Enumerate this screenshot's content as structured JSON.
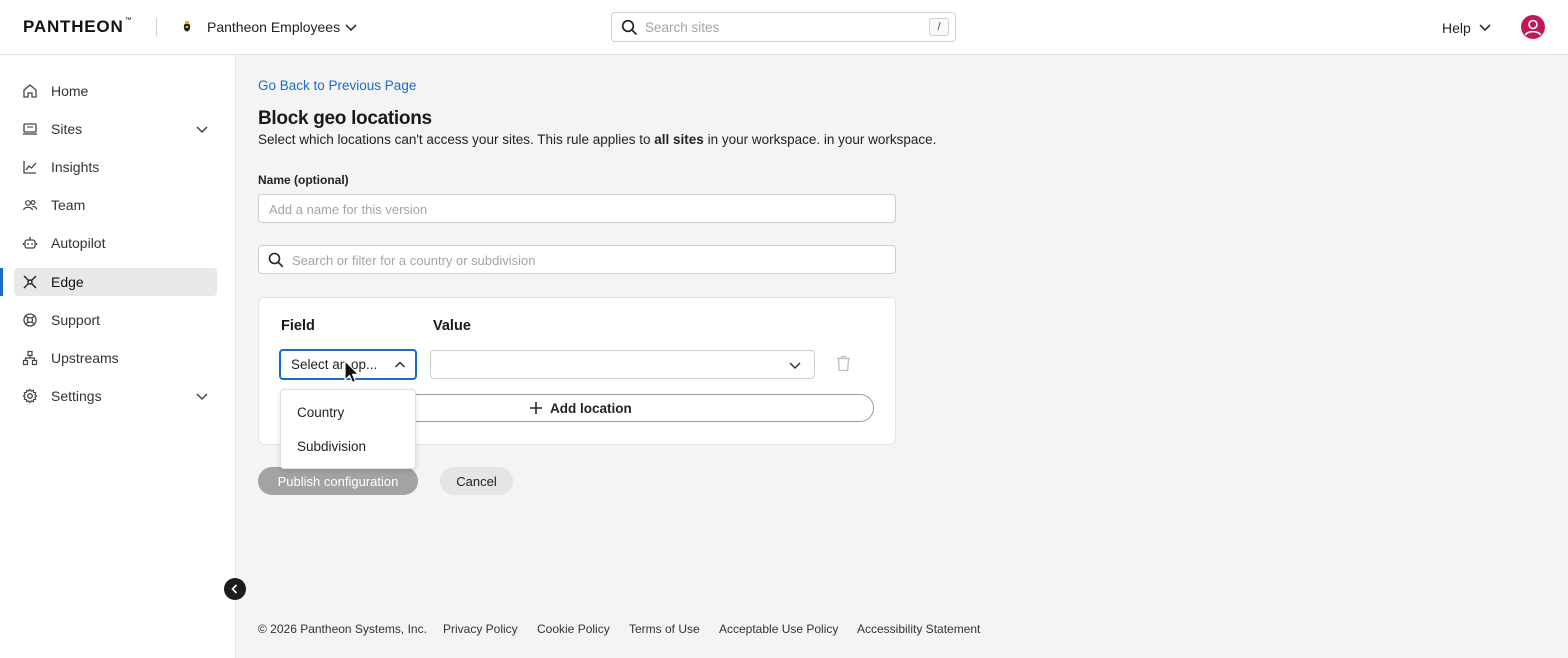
{
  "header": {
    "logo_text": "PANTHEON",
    "logo_tm": "™",
    "workspace_name": "Pantheon Employees",
    "search_placeholder": "Search sites",
    "search_shortcut": "/",
    "help_label": "Help"
  },
  "sidebar": {
    "items": [
      {
        "label": "Home",
        "icon": "home-icon"
      },
      {
        "label": "Sites",
        "icon": "sites-icon",
        "expandable": true
      },
      {
        "label": "Insights",
        "icon": "insights-icon"
      },
      {
        "label": "Team",
        "icon": "team-icon"
      },
      {
        "label": "Autopilot",
        "icon": "autopilot-icon"
      },
      {
        "label": "Edge",
        "icon": "edge-icon",
        "active": true
      },
      {
        "label": "Support",
        "icon": "support-icon"
      },
      {
        "label": "Upstreams",
        "icon": "upstreams-icon"
      },
      {
        "label": "Settings",
        "icon": "settings-icon",
        "expandable": true
      }
    ]
  },
  "main": {
    "back_link": "Go Back to Previous Page",
    "title": "Block geo locations",
    "description_prefix": "Select which locations can't access your sites. This rule applies to ",
    "description_bold": "all sites",
    "description_suffix": " in your workspace. in your workspace.",
    "name_label": "Name (optional)",
    "name_placeholder": "Add a name for this version",
    "filter_placeholder": "Search or filter for a country or subdivision",
    "rule": {
      "field_header": "Field",
      "value_header": "Value",
      "field_select_value": "Select an op...",
      "value_select_value": "",
      "field_options": [
        "Country",
        "Subdivision"
      ],
      "add_location_label": "Add location"
    },
    "publish_label": "Publish configuration",
    "cancel_label": "Cancel"
  },
  "footer": {
    "copyright": "© 2026 Pantheon Systems, Inc.",
    "links": [
      "Privacy Policy",
      "Cookie Policy",
      "Terms of Use",
      "Acceptable Use Policy",
      "Accessibility Statement"
    ]
  },
  "colors": {
    "accent": "#1a6cc6",
    "avatar": "#c2185b",
    "disabled_button": "#a3a3a3"
  }
}
